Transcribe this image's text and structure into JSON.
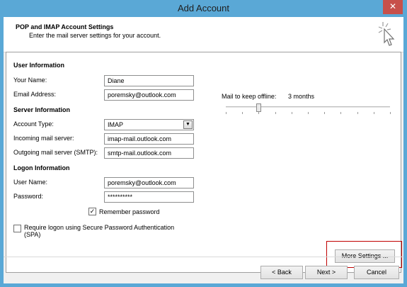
{
  "window": {
    "title": "Add Account",
    "close_glyph": "✕"
  },
  "header": {
    "title": "POP and IMAP Account Settings",
    "subtitle": "Enter the mail server settings for your account.",
    "icon": "wizard-cursor-icon"
  },
  "user_info": {
    "heading": "User Information",
    "name_label": "Your Name:",
    "name_value": "Diane",
    "email_label": "Email Address:",
    "email_value": "poremsky@outlook.com"
  },
  "server_info": {
    "heading": "Server Information",
    "account_type_label": "Account Type:",
    "account_type_value": "IMAP",
    "incoming_label": "Incoming mail server:",
    "incoming_value": "imap-mail.outlook.com",
    "outgoing_label": "Outgoing mail server (SMTP):",
    "outgoing_value": "smtp-mail.outlook.com"
  },
  "logon_info": {
    "heading": "Logon Information",
    "username_label": "User Name:",
    "username_value": "poremsky@outlook.com",
    "password_label": "Password:",
    "password_value": "**********",
    "remember_label": "Remember password",
    "remember_checked": true,
    "spa_label_line1": "Require logon using Secure Password Authentication",
    "spa_label_line2": "(SPA)",
    "spa_checked": false
  },
  "offline": {
    "label": "Mail to keep offline:",
    "value": "3 months",
    "slider_fraction": 0.2
  },
  "buttons": {
    "more_settings": "More Settings ...",
    "back": "< Back",
    "next": "Next >",
    "cancel": "Cancel"
  },
  "colors": {
    "highlight": "#c00000",
    "title_bar": "#5aa8d6",
    "close_button": "#c7504b"
  }
}
